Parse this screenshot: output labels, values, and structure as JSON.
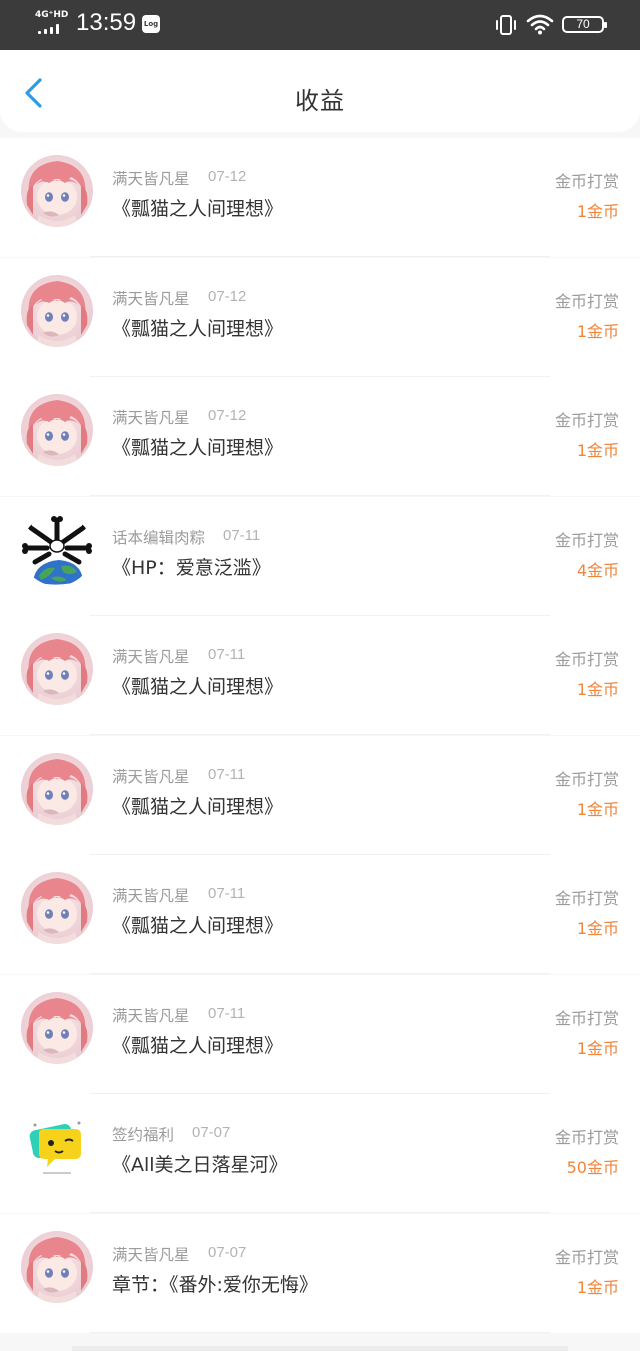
{
  "status_bar": {
    "network": "4G⁺HD",
    "time": "13:59",
    "log_badge": "Log",
    "battery": "70"
  },
  "header": {
    "title": "收益",
    "back_icon": "chevron-left-icon"
  },
  "records": [
    {
      "avatar": "anime-girl-avatar",
      "name": "满天皆凡星",
      "date": "07-12",
      "work": "《瓢猫之人间理想》",
      "type": "金币打赏",
      "amount": "1金币"
    },
    {
      "avatar": "anime-girl-avatar",
      "name": "满天皆凡星",
      "date": "07-12",
      "work": "《瓢猫之人间理想》",
      "type": "金币打赏",
      "amount": "1金币"
    },
    {
      "avatar": "anime-girl-avatar",
      "name": "满天皆凡星",
      "date": "07-12",
      "work": "《瓢猫之人间理想》",
      "type": "金币打赏",
      "amount": "1金币"
    },
    {
      "avatar": "earth-bones-avatar",
      "name": "话本编辑肉粽",
      "date": "07-11",
      "work": "《HP：爱意泛滥》",
      "type": "金币打赏",
      "amount": "4金币"
    },
    {
      "avatar": "anime-girl-avatar",
      "name": "满天皆凡星",
      "date": "07-11",
      "work": "《瓢猫之人间理想》",
      "type": "金币打赏",
      "amount": "1金币"
    },
    {
      "avatar": "anime-girl-avatar",
      "name": "满天皆凡星",
      "date": "07-11",
      "work": "《瓢猫之人间理想》",
      "type": "金币打赏",
      "amount": "1金币"
    },
    {
      "avatar": "anime-girl-avatar",
      "name": "满天皆凡星",
      "date": "07-11",
      "work": "《瓢猫之人间理想》",
      "type": "金币打赏",
      "amount": "1金币"
    },
    {
      "avatar": "anime-girl-avatar",
      "name": "满天皆凡星",
      "date": "07-11",
      "work": "《瓢猫之人间理想》",
      "type": "金币打赏",
      "amount": "1金币"
    },
    {
      "avatar": "yellow-chat-bubble-avatar",
      "name": "签约福利",
      "date": "07-07",
      "work": "《All美之日落星河》",
      "type": "金币打赏",
      "amount": "50金币"
    },
    {
      "avatar": "anime-girl-avatar",
      "name": "满天皆凡星",
      "date": "07-07",
      "work": "章节：《番外:爱你无悔》",
      "type": "金币打赏",
      "amount": "1金币"
    }
  ],
  "colors": {
    "amount": "#f0853c",
    "accent": "#2d9be8",
    "status_bar": "#3b3b3b"
  }
}
